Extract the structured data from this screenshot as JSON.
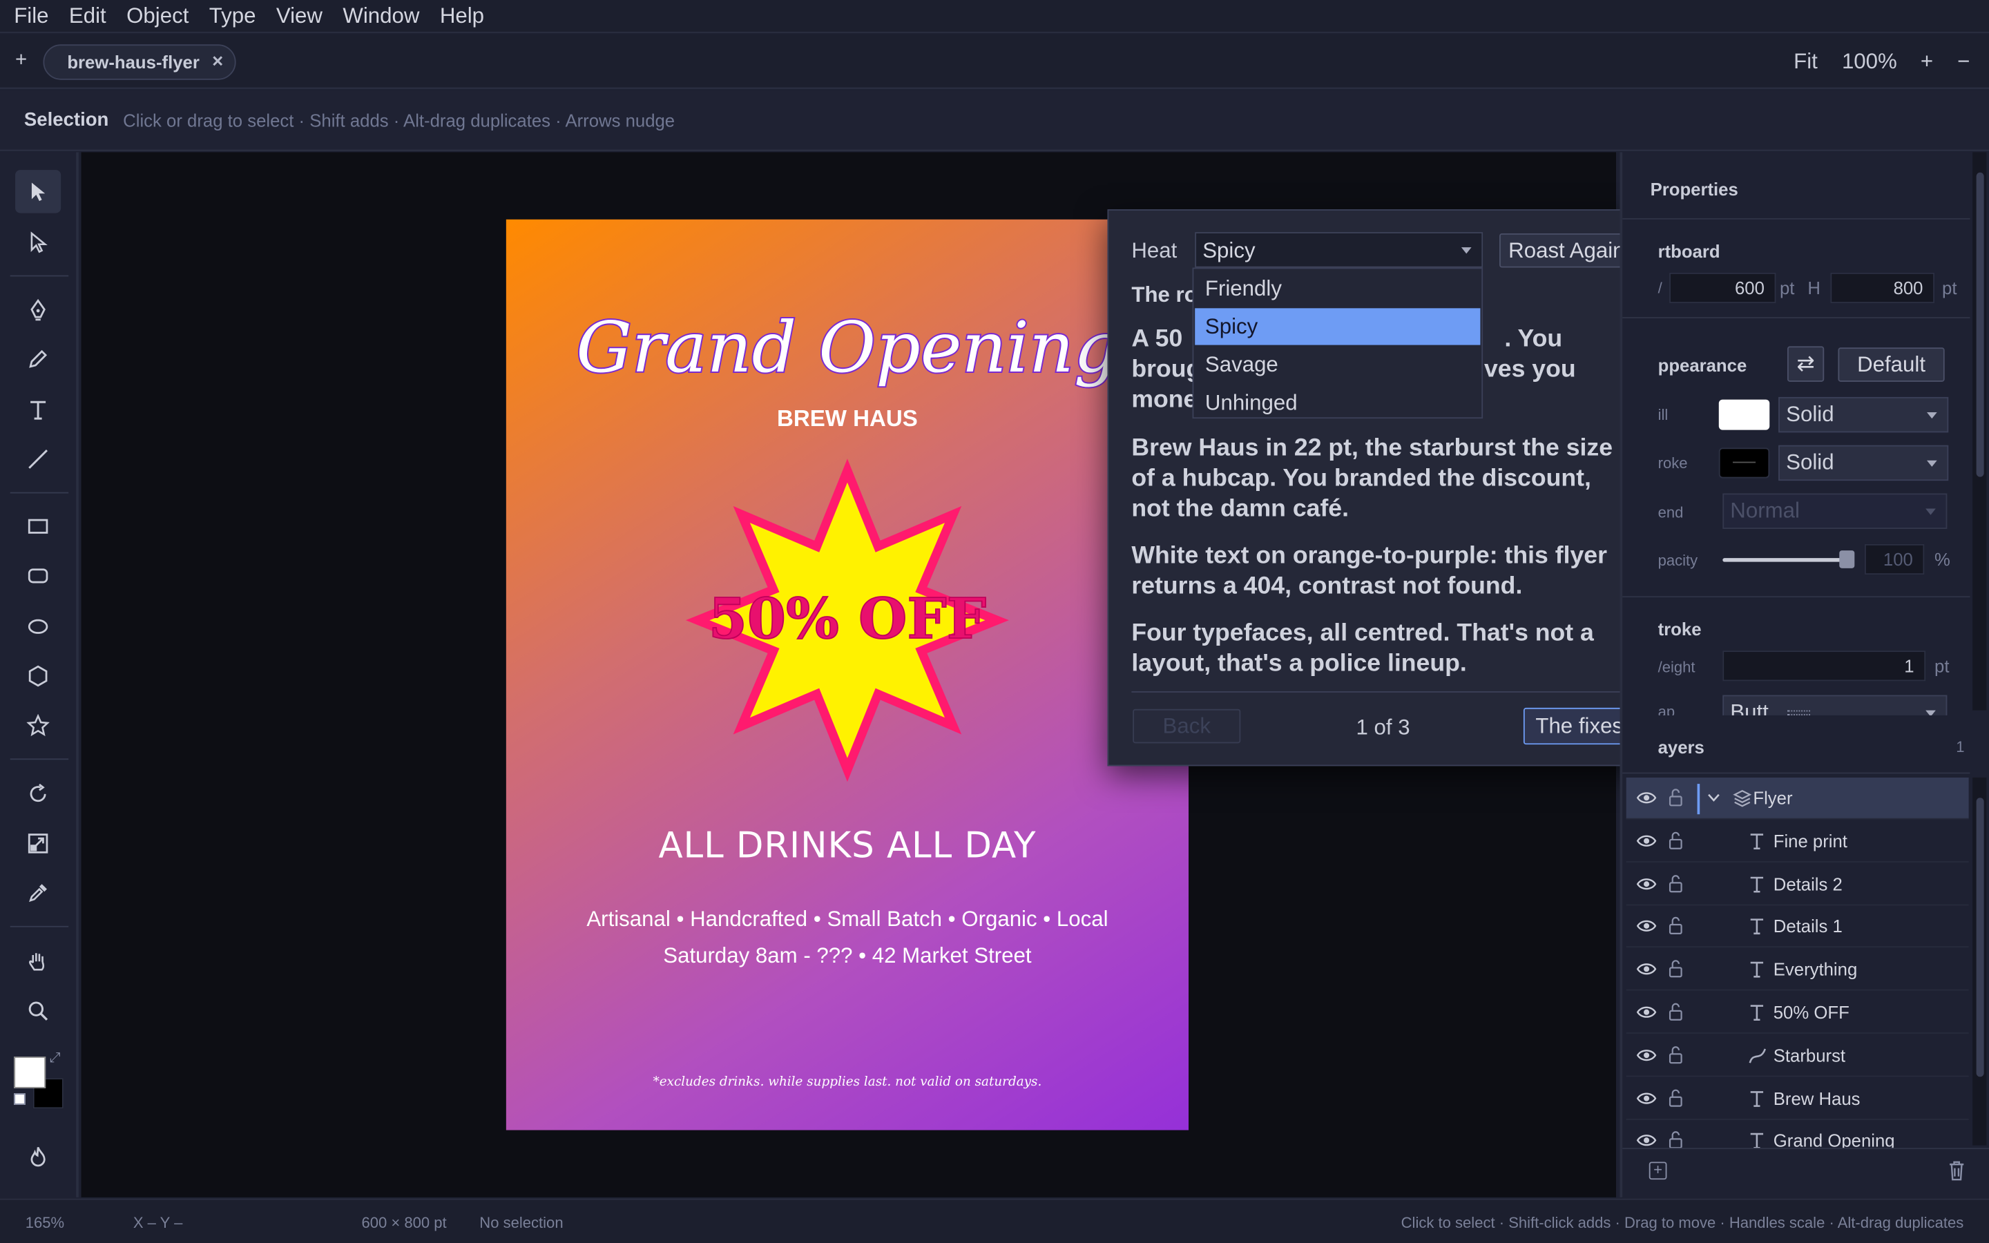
{
  "menu": [
    "File",
    "Edit",
    "Object",
    "Type",
    "View",
    "Window",
    "Help"
  ],
  "tabs": {
    "new_label": "+",
    "active": "brew-haus-flyer",
    "close": "×"
  },
  "zoom": {
    "fit": "Fit",
    "level": "100%",
    "in": "+",
    "out": "−"
  },
  "control": {
    "tool": "Selection",
    "hint": "Click or drag to select · Shift adds · Alt-drag duplicates · Arrows nudge"
  },
  "flyer": {
    "title": "Grand Opening",
    "brand": "BREW HAUS",
    "burst": "50% OFF",
    "headline": "ALL DRINKS ALL DAY",
    "details1": "Artisanal • Handcrafted • Small Batch • Organic • Local",
    "details2": "Saturday 8am - ??? • 42 Market Street",
    "fine": "*excludes drinks. while supplies last. not valid on saturdays."
  },
  "roast": {
    "heat_label": "Heat",
    "heat_value": "Spicy",
    "options": [
      "Friendly",
      "Spicy",
      "Savage",
      "Unhinged"
    ],
    "again": "Roast Again",
    "heading": "The ro",
    "p1_l1": "A 50",
    "p1_l1b": ". You",
    "p1_l2": "broug",
    "p1_l2b": "ves you",
    "p1_l3": "mone",
    "p2": "Brew Haus in 22 pt, the starburst the size of a hubcap. You branded the discount, not the damn café.",
    "p3": "White text on orange-to-purple: this flyer returns a 404, contrast not found.",
    "p4": "Four typefaces, all centred. That's not a layout, that's a police lineup.",
    "back": "Back",
    "pager": "1 of 3",
    "fixes": "The fixes"
  },
  "properties": {
    "title": "Properties",
    "artboard": "rtboard",
    "w_label": "/",
    "w": "600",
    "unit": "pt",
    "h_label": "H",
    "h": "800",
    "appearance": "ppearance",
    "default": "Default",
    "fill_label": "ill",
    "fill_style": "Solid",
    "stroke_label": "roke",
    "stroke_style": "Solid",
    "blend_label": "end",
    "blend": "Normal",
    "opacity_label": "pacity",
    "opacity": "100",
    "pct": "%",
    "stroke_title": "troke",
    "weight_label": "/eight",
    "weight": "1",
    "cap_label": "ap",
    "cap": "Butt",
    "colors": {
      "fill": "#ffffff",
      "stroke": "#000000"
    }
  },
  "layers": {
    "title": "ayers",
    "count": "1",
    "items": [
      {
        "name": "Flyer",
        "icon": "group-icon"
      },
      {
        "name": "Fine print",
        "icon": "text-icon"
      },
      {
        "name": "Details 2",
        "icon": "text-icon"
      },
      {
        "name": "Details 1",
        "icon": "text-icon"
      },
      {
        "name": "Everything",
        "icon": "text-icon"
      },
      {
        "name": "50% OFF",
        "icon": "text-icon"
      },
      {
        "name": "Starburst",
        "icon": "path-icon"
      },
      {
        "name": "Brew Haus",
        "icon": "text-icon"
      },
      {
        "name": "Grand Opening",
        "icon": "text-icon"
      }
    ]
  },
  "status": {
    "zoom": "165%",
    "xy": "X –  Y –",
    "size": "600 × 800 pt",
    "selection": "No selection",
    "hint": "Click to select · Shift-click adds · Drag to move · Handles scale · Alt-drag duplicates"
  },
  "colors": {
    "accent": "#6e9cf4",
    "burst_fill": "#fff200",
    "burst_stroke": "#ff1a6e",
    "title": "#7a2bd0"
  }
}
